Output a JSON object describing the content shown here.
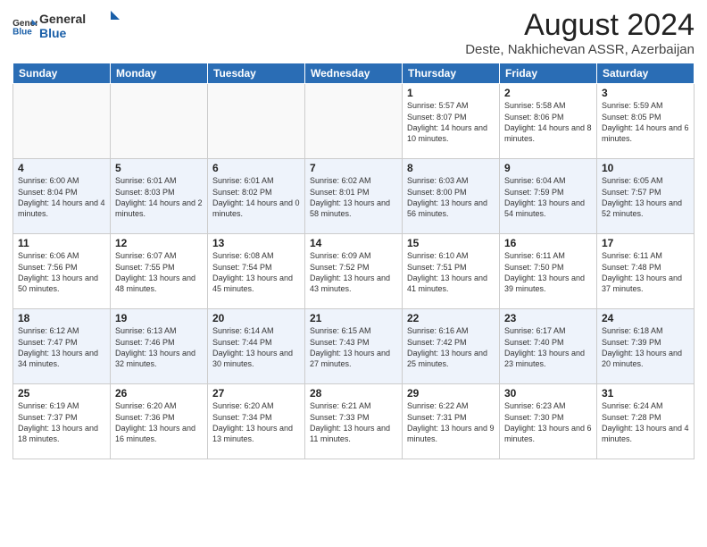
{
  "header": {
    "logo_general": "General",
    "logo_blue": "Blue",
    "month_year": "August 2024",
    "location": "Deste, Nakhichevan ASSR, Azerbaijan"
  },
  "weekdays": [
    "Sunday",
    "Monday",
    "Tuesday",
    "Wednesday",
    "Thursday",
    "Friday",
    "Saturday"
  ],
  "weeks": [
    [
      {
        "day": "",
        "info": ""
      },
      {
        "day": "",
        "info": ""
      },
      {
        "day": "",
        "info": ""
      },
      {
        "day": "",
        "info": ""
      },
      {
        "day": "1",
        "info": "Sunrise: 5:57 AM\nSunset: 8:07 PM\nDaylight: 14 hours\nand 10 minutes."
      },
      {
        "day": "2",
        "info": "Sunrise: 5:58 AM\nSunset: 8:06 PM\nDaylight: 14 hours\nand 8 minutes."
      },
      {
        "day": "3",
        "info": "Sunrise: 5:59 AM\nSunset: 8:05 PM\nDaylight: 14 hours\nand 6 minutes."
      }
    ],
    [
      {
        "day": "4",
        "info": "Sunrise: 6:00 AM\nSunset: 8:04 PM\nDaylight: 14 hours\nand 4 minutes."
      },
      {
        "day": "5",
        "info": "Sunrise: 6:01 AM\nSunset: 8:03 PM\nDaylight: 14 hours\nand 2 minutes."
      },
      {
        "day": "6",
        "info": "Sunrise: 6:01 AM\nSunset: 8:02 PM\nDaylight: 14 hours\nand 0 minutes."
      },
      {
        "day": "7",
        "info": "Sunrise: 6:02 AM\nSunset: 8:01 PM\nDaylight: 13 hours\nand 58 minutes."
      },
      {
        "day": "8",
        "info": "Sunrise: 6:03 AM\nSunset: 8:00 PM\nDaylight: 13 hours\nand 56 minutes."
      },
      {
        "day": "9",
        "info": "Sunrise: 6:04 AM\nSunset: 7:59 PM\nDaylight: 13 hours\nand 54 minutes."
      },
      {
        "day": "10",
        "info": "Sunrise: 6:05 AM\nSunset: 7:57 PM\nDaylight: 13 hours\nand 52 minutes."
      }
    ],
    [
      {
        "day": "11",
        "info": "Sunrise: 6:06 AM\nSunset: 7:56 PM\nDaylight: 13 hours\nand 50 minutes."
      },
      {
        "day": "12",
        "info": "Sunrise: 6:07 AM\nSunset: 7:55 PM\nDaylight: 13 hours\nand 48 minutes."
      },
      {
        "day": "13",
        "info": "Sunrise: 6:08 AM\nSunset: 7:54 PM\nDaylight: 13 hours\nand 45 minutes."
      },
      {
        "day": "14",
        "info": "Sunrise: 6:09 AM\nSunset: 7:52 PM\nDaylight: 13 hours\nand 43 minutes."
      },
      {
        "day": "15",
        "info": "Sunrise: 6:10 AM\nSunset: 7:51 PM\nDaylight: 13 hours\nand 41 minutes."
      },
      {
        "day": "16",
        "info": "Sunrise: 6:11 AM\nSunset: 7:50 PM\nDaylight: 13 hours\nand 39 minutes."
      },
      {
        "day": "17",
        "info": "Sunrise: 6:11 AM\nSunset: 7:48 PM\nDaylight: 13 hours\nand 37 minutes."
      }
    ],
    [
      {
        "day": "18",
        "info": "Sunrise: 6:12 AM\nSunset: 7:47 PM\nDaylight: 13 hours\nand 34 minutes."
      },
      {
        "day": "19",
        "info": "Sunrise: 6:13 AM\nSunset: 7:46 PM\nDaylight: 13 hours\nand 32 minutes."
      },
      {
        "day": "20",
        "info": "Sunrise: 6:14 AM\nSunset: 7:44 PM\nDaylight: 13 hours\nand 30 minutes."
      },
      {
        "day": "21",
        "info": "Sunrise: 6:15 AM\nSunset: 7:43 PM\nDaylight: 13 hours\nand 27 minutes."
      },
      {
        "day": "22",
        "info": "Sunrise: 6:16 AM\nSunset: 7:42 PM\nDaylight: 13 hours\nand 25 minutes."
      },
      {
        "day": "23",
        "info": "Sunrise: 6:17 AM\nSunset: 7:40 PM\nDaylight: 13 hours\nand 23 minutes."
      },
      {
        "day": "24",
        "info": "Sunrise: 6:18 AM\nSunset: 7:39 PM\nDaylight: 13 hours\nand 20 minutes."
      }
    ],
    [
      {
        "day": "25",
        "info": "Sunrise: 6:19 AM\nSunset: 7:37 PM\nDaylight: 13 hours\nand 18 minutes."
      },
      {
        "day": "26",
        "info": "Sunrise: 6:20 AM\nSunset: 7:36 PM\nDaylight: 13 hours\nand 16 minutes."
      },
      {
        "day": "27",
        "info": "Sunrise: 6:20 AM\nSunset: 7:34 PM\nDaylight: 13 hours\nand 13 minutes."
      },
      {
        "day": "28",
        "info": "Sunrise: 6:21 AM\nSunset: 7:33 PM\nDaylight: 13 hours\nand 11 minutes."
      },
      {
        "day": "29",
        "info": "Sunrise: 6:22 AM\nSunset: 7:31 PM\nDaylight: 13 hours\nand 9 minutes."
      },
      {
        "day": "30",
        "info": "Sunrise: 6:23 AM\nSunset: 7:30 PM\nDaylight: 13 hours\nand 6 minutes."
      },
      {
        "day": "31",
        "info": "Sunrise: 6:24 AM\nSunset: 7:28 PM\nDaylight: 13 hours\nand 4 minutes."
      }
    ]
  ]
}
